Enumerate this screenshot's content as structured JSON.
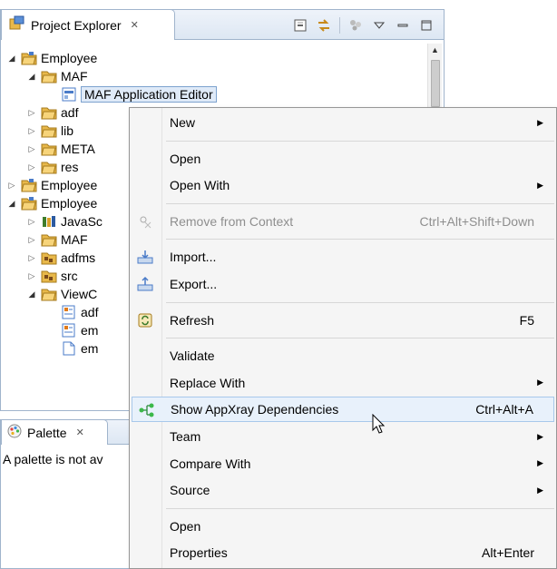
{
  "project_explorer": {
    "tab_title": "Project Explorer",
    "close_glyph": "✕",
    "toolbar_icons": [
      "collapse-all-icon",
      "link-with-editor-icon",
      "filter-icon",
      "view-menu-icon",
      "minimize-icon",
      "maximize-icon"
    ],
    "tree": [
      {
        "label": "Employee",
        "level": 0,
        "expanded": true,
        "icon": "project-folder-icon"
      },
      {
        "label": "MAF",
        "level": 1,
        "expanded": true,
        "icon": "folder-icon"
      },
      {
        "label": "MAF Application Editor",
        "level": 2,
        "expanded": null,
        "icon": "editor-file-icon",
        "selected": true
      },
      {
        "label": "adf",
        "level": 1,
        "expanded": false,
        "icon": "folder-icon"
      },
      {
        "label": "lib",
        "level": 1,
        "expanded": false,
        "icon": "folder-icon"
      },
      {
        "label": "META",
        "level": 1,
        "expanded": false,
        "icon": "folder-icon"
      },
      {
        "label": "res",
        "level": 1,
        "expanded": false,
        "icon": "folder-icon"
      },
      {
        "label": "Employee",
        "level": 0,
        "expanded": false,
        "icon": "project-folder-icon"
      },
      {
        "label": "Employee",
        "level": 0,
        "expanded": true,
        "icon": "project-folder-icon"
      },
      {
        "label": "JavaSc",
        "level": 1,
        "expanded": false,
        "icon": "library-icon"
      },
      {
        "label": "MAF",
        "level": 1,
        "expanded": false,
        "icon": "folder-icon"
      },
      {
        "label": "adfms",
        "level": 1,
        "expanded": false,
        "icon": "package-folder-icon"
      },
      {
        "label": "src",
        "level": 1,
        "expanded": false,
        "icon": "package-folder-icon"
      },
      {
        "label": "ViewC",
        "level": 1,
        "expanded": true,
        "icon": "folder-icon"
      },
      {
        "label": "adf",
        "level": 2,
        "expanded": null,
        "icon": "config-file-icon"
      },
      {
        "label": "em",
        "level": 2,
        "expanded": null,
        "icon": "config-file-icon"
      },
      {
        "label": "em",
        "level": 2,
        "expanded": null,
        "icon": "file-icon"
      }
    ]
  },
  "palette": {
    "tab_title": "Palette",
    "close_glyph": "✕",
    "message": "A palette is not av"
  },
  "context_menu": {
    "items": [
      {
        "type": "item",
        "label": "New",
        "submenu": true
      },
      {
        "type": "separator"
      },
      {
        "type": "item",
        "label": "Open"
      },
      {
        "type": "item",
        "label": "Open With",
        "submenu": true
      },
      {
        "type": "separator"
      },
      {
        "type": "item",
        "label": "Remove from Context",
        "shortcut": "Ctrl+Alt+Shift+Down",
        "disabled": true,
        "icon": "remove-from-context-icon"
      },
      {
        "type": "separator"
      },
      {
        "type": "item",
        "label": "Import...",
        "icon": "import-icon"
      },
      {
        "type": "item",
        "label": "Export...",
        "icon": "export-icon"
      },
      {
        "type": "separator"
      },
      {
        "type": "item",
        "label": "Refresh",
        "shortcut": "F5",
        "icon": "refresh-icon"
      },
      {
        "type": "separator"
      },
      {
        "type": "item",
        "label": "Validate"
      },
      {
        "type": "item",
        "label": "Replace With",
        "submenu": true
      },
      {
        "type": "item",
        "label": "Show AppXray Dependencies",
        "shortcut": "Ctrl+Alt+A",
        "icon": "appxray-icon",
        "hover": true
      },
      {
        "type": "item",
        "label": "Team",
        "submenu": true
      },
      {
        "type": "item",
        "label": "Compare With",
        "submenu": true
      },
      {
        "type": "item",
        "label": "Source",
        "submenu": true
      },
      {
        "type": "separator"
      },
      {
        "type": "item",
        "label": "Open"
      },
      {
        "type": "item",
        "label": "Properties",
        "shortcut": "Alt+Enter"
      }
    ]
  },
  "colors": {
    "folder": "#e8b84a",
    "project_blue": "#4a7bc8",
    "hover_bg": "#e8f1fb",
    "tab_border": "#a0b4cc"
  }
}
